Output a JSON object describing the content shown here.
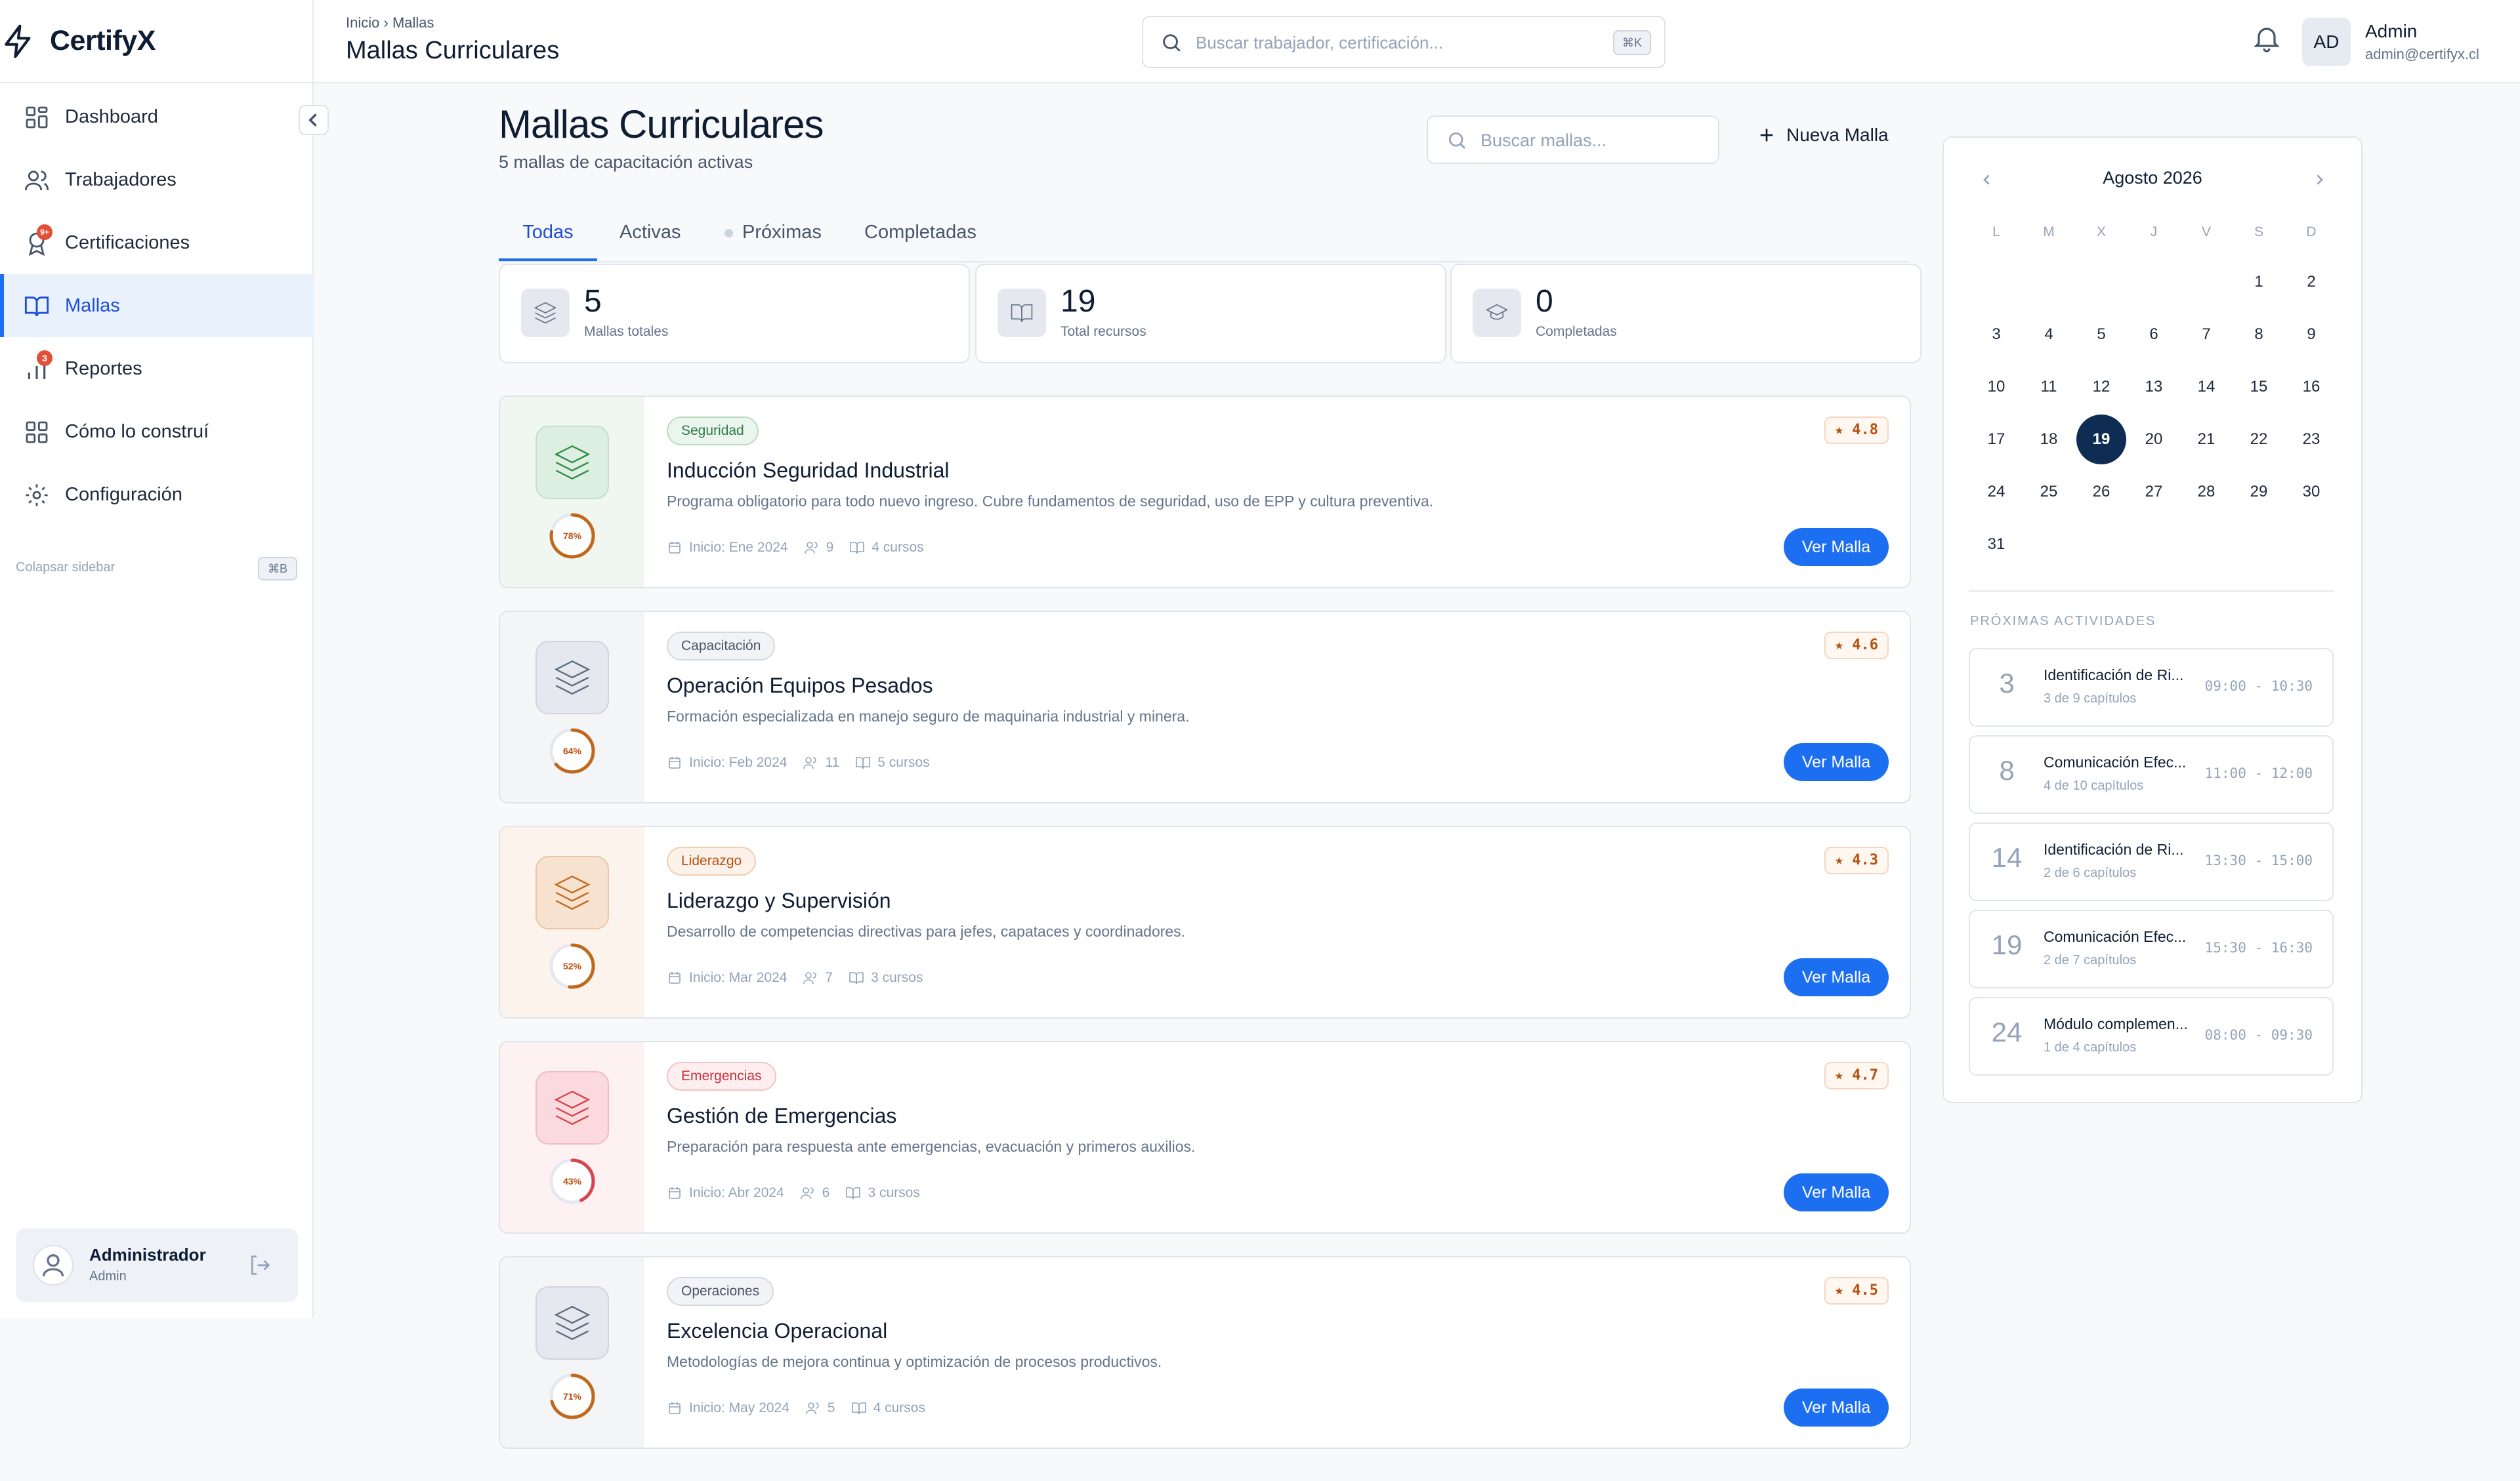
{
  "app": {
    "name": "CertifyX"
  },
  "sidebar": {
    "items": [
      {
        "label": "Dashboard"
      },
      {
        "label": "Trabajadores"
      },
      {
        "label": "Certificaciones",
        "badge": "9+"
      },
      {
        "label": "Mallas"
      },
      {
        "label": "Reportes",
        "badge": "3"
      },
      {
        "label": "Cómo lo construí"
      },
      {
        "label": "Configuración"
      }
    ],
    "collapse_label": "Colapsar sidebar",
    "collapse_kbd": "⌘B",
    "user": {
      "name": "Administrador",
      "role": "Admin"
    }
  },
  "header": {
    "breadcrumb": [
      "Inicio",
      "Mallas"
    ],
    "title": "Mallas Curriculares",
    "search_placeholder": "Buscar trabajador, certificación...",
    "search_kbd": "⌘K",
    "user_initials": "AD",
    "user_name": "Admin",
    "user_email": "admin@certifyx.cl"
  },
  "main": {
    "title": "Mallas Curriculares",
    "subtitle": "5 mallas de capacitación activas",
    "search_placeholder": "Buscar mallas...",
    "new_button": "Nueva Malla",
    "tabs": [
      {
        "label": "Todas"
      },
      {
        "label": "Activas"
      },
      {
        "label": "Próximas"
      },
      {
        "label": "Completadas"
      }
    ],
    "stats": [
      {
        "value": "5",
        "label": "Mallas totales"
      },
      {
        "value": "19",
        "label": "Total recursos"
      },
      {
        "value": "0",
        "label": "Completadas"
      }
    ],
    "cards": [
      {
        "tag": "Seguridad",
        "title": "Inducción Seguridad Industrial",
        "description": "Programa obligatorio para todo nuevo ingreso. Cubre fundamentos de seguridad, uso de EPP y cultura preventiva.",
        "start": "Inicio: Ene 2024",
        "people": "9",
        "courses": "4 cursos",
        "rating": "4.8",
        "progress_label": "78%",
        "progress": 78,
        "button": "Ver Malla",
        "color": "#2f8a4a"
      },
      {
        "tag": "Capacitación",
        "title": "Operación Equipos Pesados",
        "description": "Formación especializada en manejo seguro de maquinaria industrial y minera.",
        "start": "Inicio: Feb 2024",
        "people": "11",
        "courses": "5 cursos",
        "rating": "4.6",
        "progress_label": "64%",
        "progress": 64,
        "button": "Ver Malla",
        "color": "#5b6b82"
      },
      {
        "tag": "Liderazgo",
        "title": "Liderazgo y Supervisión",
        "description": "Desarrollo de competencias directivas para jefes, capataces y coordinadores.",
        "start": "Inicio: Mar 2024",
        "people": "7",
        "courses": "3 cursos",
        "rating": "4.3",
        "progress_label": "52%",
        "progress": 52,
        "button": "Ver Malla",
        "color": "#c2681c"
      },
      {
        "tag": "Emergencias",
        "title": "Gestión de Emergencias",
        "description": "Preparación para respuesta ante emergencias, evacuación y primeros auxilios.",
        "start": "Inicio: Abr 2024",
        "people": "6",
        "courses": "3 cursos",
        "rating": "4.7",
        "progress_label": "43%",
        "progress": 43,
        "button": "Ver Malla",
        "color": "#d8434d"
      },
      {
        "tag": "Operaciones",
        "title": "Excelencia Operacional",
        "description": "Metodologías de mejora continua y optimización de procesos productivos.",
        "start": "Inicio: May 2024",
        "people": "5",
        "courses": "4 cursos",
        "rating": "4.5",
        "progress_label": "71%",
        "progress": 71,
        "button": "Ver Malla",
        "color": "#5b6b82"
      }
    ]
  },
  "calendar": {
    "month": "Agosto 2026",
    "weekdays": [
      "L",
      "M",
      "X",
      "J",
      "V",
      "S",
      "D"
    ],
    "selected": "19",
    "days": [
      "1",
      "2",
      "3",
      "4",
      "5",
      "6",
      "7",
      "8",
      "9",
      "10",
      "11",
      "12",
      "13",
      "14",
      "15",
      "16",
      "17",
      "18",
      "19",
      "20",
      "21",
      "22",
      "23",
      "24",
      "25",
      "26",
      "27",
      "28",
      "29",
      "30",
      "31"
    ],
    "activities_title": "PRÓXIMAS ACTIVIDADES",
    "activities": [
      {
        "day": "3",
        "name": "Identificación de Ri...",
        "sub": "3 de 9 capítulos",
        "time": "09:00 - 10:30"
      },
      {
        "day": "8",
        "name": "Comunicación Efec...",
        "sub": "4 de 10 capítulos",
        "time": "11:00 - 12:00"
      },
      {
        "day": "14",
        "name": "Identificación de Ri...",
        "sub": "2 de 6 capítulos",
        "time": "13:30 - 15:00"
      },
      {
        "day": "19",
        "name": "Comunicación Efec...",
        "sub": "2 de 7 capítulos",
        "time": "15:30 - 16:30"
      },
      {
        "day": "24",
        "name": "Módulo complemen...",
        "sub": "1 de 4 capítulos",
        "time": "08:00 - 09:30"
      }
    ]
  }
}
